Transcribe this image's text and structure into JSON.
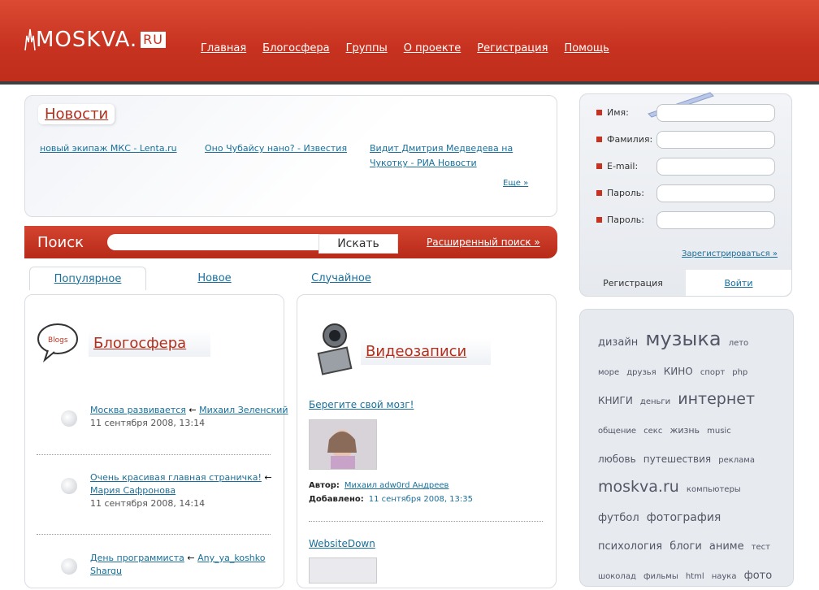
{
  "header": {
    "logo_main": "MOSKVA.",
    "logo_ru": "RU",
    "nav": [
      "Главная",
      "Блогосфера",
      "Группы",
      "О проекте",
      "Регистрация",
      "Помощь"
    ]
  },
  "news": {
    "title": "Новости",
    "items": [
      "новый экипаж МКС - Lenta.ru",
      "Оно Чубайсу нано? - Известия",
      "Видит Дмитрия Медведева на Чукотку - РИА Новости"
    ],
    "more": "Еще »"
  },
  "search": {
    "label": "Поиск",
    "placeholder": "",
    "button": "Искать",
    "advanced": "Расширенный поиск »"
  },
  "tabs": [
    "Популярное",
    "Новое",
    "Случайное"
  ],
  "blogs": {
    "badge": "Blogs",
    "title": "Блогосфера",
    "entries": [
      {
        "title": "Москва развивается",
        "arrow": " ← ",
        "author": "Михаил Зеленский",
        "date": "11 сентября 2008, 13:14"
      },
      {
        "title": "Очень красивая главная страничка!",
        "arrow": " ← ",
        "author": "Мария Сафронова",
        "date": "11 сентября 2008, 14:14"
      },
      {
        "title": "День программиста",
        "arrow": " ← ",
        "author": "Any_ya_koshko Shargu",
        "date": ""
      }
    ]
  },
  "videos": {
    "title": "Видеозаписи",
    "items": [
      {
        "title": "Берегите свой мозг!",
        "author_label": "Автор:",
        "author": "Михаил adw0rd Андреев",
        "added_label": "Добавлено:",
        "added": "11 сентября 2008, 13:35"
      },
      {
        "title": "WebsiteDown"
      }
    ]
  },
  "registration": {
    "fields": [
      "Имя:",
      "Фамилия:",
      "E-mail:",
      "Пароль:",
      "Пароль:"
    ],
    "register_link": "Зарегистрироваться »",
    "tab_register": "Регистрация",
    "tab_login": "Войти"
  },
  "tags": [
    {
      "text": "дизайн",
      "size": 13
    },
    {
      "text": "музыка",
      "size": 24
    },
    {
      "text": "лето",
      "size": 10
    },
    {
      "text": "море",
      "size": 10
    },
    {
      "text": "друзья",
      "size": 10
    },
    {
      "text": "КИНО",
      "size": 12
    },
    {
      "text": "спорт",
      "size": 10
    },
    {
      "text": "php",
      "size": 10
    },
    {
      "text": "КНИГИ",
      "size": 12
    },
    {
      "text": "деньги",
      "size": 10
    },
    {
      "text": "интернет",
      "size": 19
    },
    {
      "text": "общение",
      "size": 10
    },
    {
      "text": "секс",
      "size": 10
    },
    {
      "text": "жизнь",
      "size": 11
    },
    {
      "text": "music",
      "size": 10
    },
    {
      "text": "любовь",
      "size": 12
    },
    {
      "text": "путешествия",
      "size": 12
    },
    {
      "text": "реклама",
      "size": 10
    },
    {
      "text": "moskva.ru",
      "size": 19
    },
    {
      "text": "компьютеры",
      "size": 10
    },
    {
      "text": "футбол",
      "size": 13
    },
    {
      "text": "фотография",
      "size": 14
    },
    {
      "text": "психология",
      "size": 13
    },
    {
      "text": "блоги",
      "size": 13
    },
    {
      "text": "аниме",
      "size": 13
    },
    {
      "text": "тест",
      "size": 10
    },
    {
      "text": "шоколад",
      "size": 10
    },
    {
      "text": "фильмы",
      "size": 10
    },
    {
      "text": "html",
      "size": 10
    },
    {
      "text": "наука",
      "size": 10
    },
    {
      "text": "фото",
      "size": 13
    }
  ]
}
